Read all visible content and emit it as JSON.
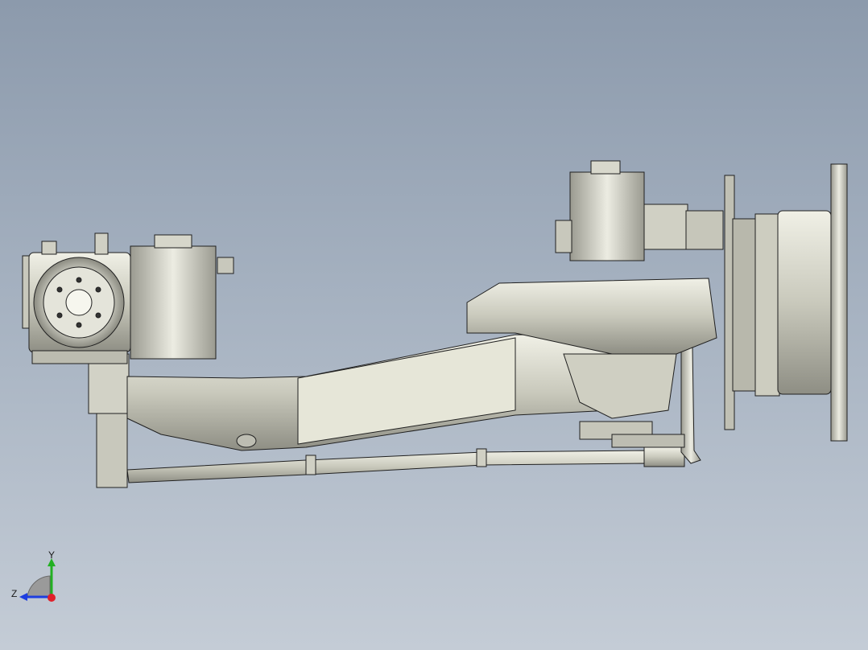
{
  "viewport": {
    "background_top": "#8c9aac",
    "background_bottom": "#c4ccd6",
    "model_fill": "#d8d8cc",
    "model_shade": "#a8a89c",
    "edge_color": "#202020"
  },
  "triad": {
    "x_label": "",
    "y_label": "Y",
    "z_label": "Z",
    "x_color": "#e0202a",
    "y_color": "#22b022",
    "z_color": "#1e3ee0"
  }
}
